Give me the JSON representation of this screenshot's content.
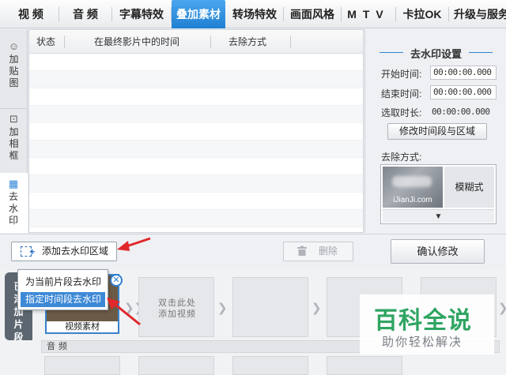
{
  "tabs": [
    {
      "label": "视 频"
    },
    {
      "label": "音 频"
    },
    {
      "label": "字幕特效"
    },
    {
      "label": "叠加素材",
      "active": true
    },
    {
      "label": "转场特效"
    },
    {
      "label": "画面风格"
    },
    {
      "label": "MTV"
    },
    {
      "label": "卡拉OK"
    },
    {
      "label": "升级与服务"
    }
  ],
  "side_tabs": [
    {
      "label": "加贴图",
      "icon": "smiley-icon"
    },
    {
      "label": "加相框",
      "icon": "frame-icon"
    },
    {
      "label": "去水印",
      "icon": "mosaic-icon",
      "active": true
    }
  ],
  "table": {
    "headers": [
      "状态",
      "在最终影片中的时间",
      "去除方式"
    ]
  },
  "settings": {
    "title": "去水印设置",
    "start_label": "开始时间:",
    "start_value": "00:00:00.000",
    "end_label": "结束时间:",
    "end_value": "00:00:00.000",
    "duration_label": "选取时长:",
    "duration_value": "00:00:00.000",
    "modify_button": "修改时间段与区域",
    "removal_label": "去除方式:",
    "mode_thumb_text": "iJianJi.com",
    "mode_name": "模糊式",
    "dropdown_glyph": "▼"
  },
  "actions": {
    "add_region": "添加去水印区域",
    "delete": "删除",
    "confirm": "确认修改"
  },
  "popup": {
    "items": [
      "为当前片段去水印",
      "指定时间段去水印"
    ]
  },
  "timeline": {
    "side_label": "已添加片段",
    "video_caption": "视频素材",
    "empty_hint_line1": "双击此处",
    "empty_hint_line2": "添加视频",
    "audio_label": "音频"
  },
  "brand": {
    "line1": "百科全说",
    "line2": "助你轻松解决"
  },
  "colors": {
    "accent": "#1f7fd1",
    "brand_green": "#2fa562",
    "arrow_red": "#e0282a"
  }
}
